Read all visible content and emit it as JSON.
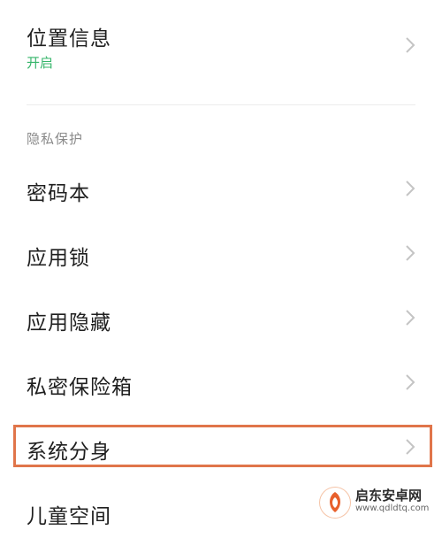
{
  "location": {
    "label": "位置信息",
    "status": "开启"
  },
  "privacy_section": {
    "title": "隐私保护",
    "items": [
      {
        "label": "密码本"
      },
      {
        "label": "应用锁"
      },
      {
        "label": "应用隐藏"
      },
      {
        "label": "私密保险箱"
      },
      {
        "label": "系统分身"
      },
      {
        "label": "儿童空间"
      }
    ]
  },
  "highlight": {
    "color": "#e0754a",
    "target": "系统分身"
  },
  "colors": {
    "status_on": "#35b56a",
    "chevron": "#c4c4c4",
    "section_title": "#8a8a8a"
  },
  "icons": {
    "chevron": "chevron-right-icon",
    "watermark_logo": "qidong-logo-icon"
  },
  "watermark": {
    "title": "启东安卓网",
    "url": "www.qdldtq.com"
  }
}
